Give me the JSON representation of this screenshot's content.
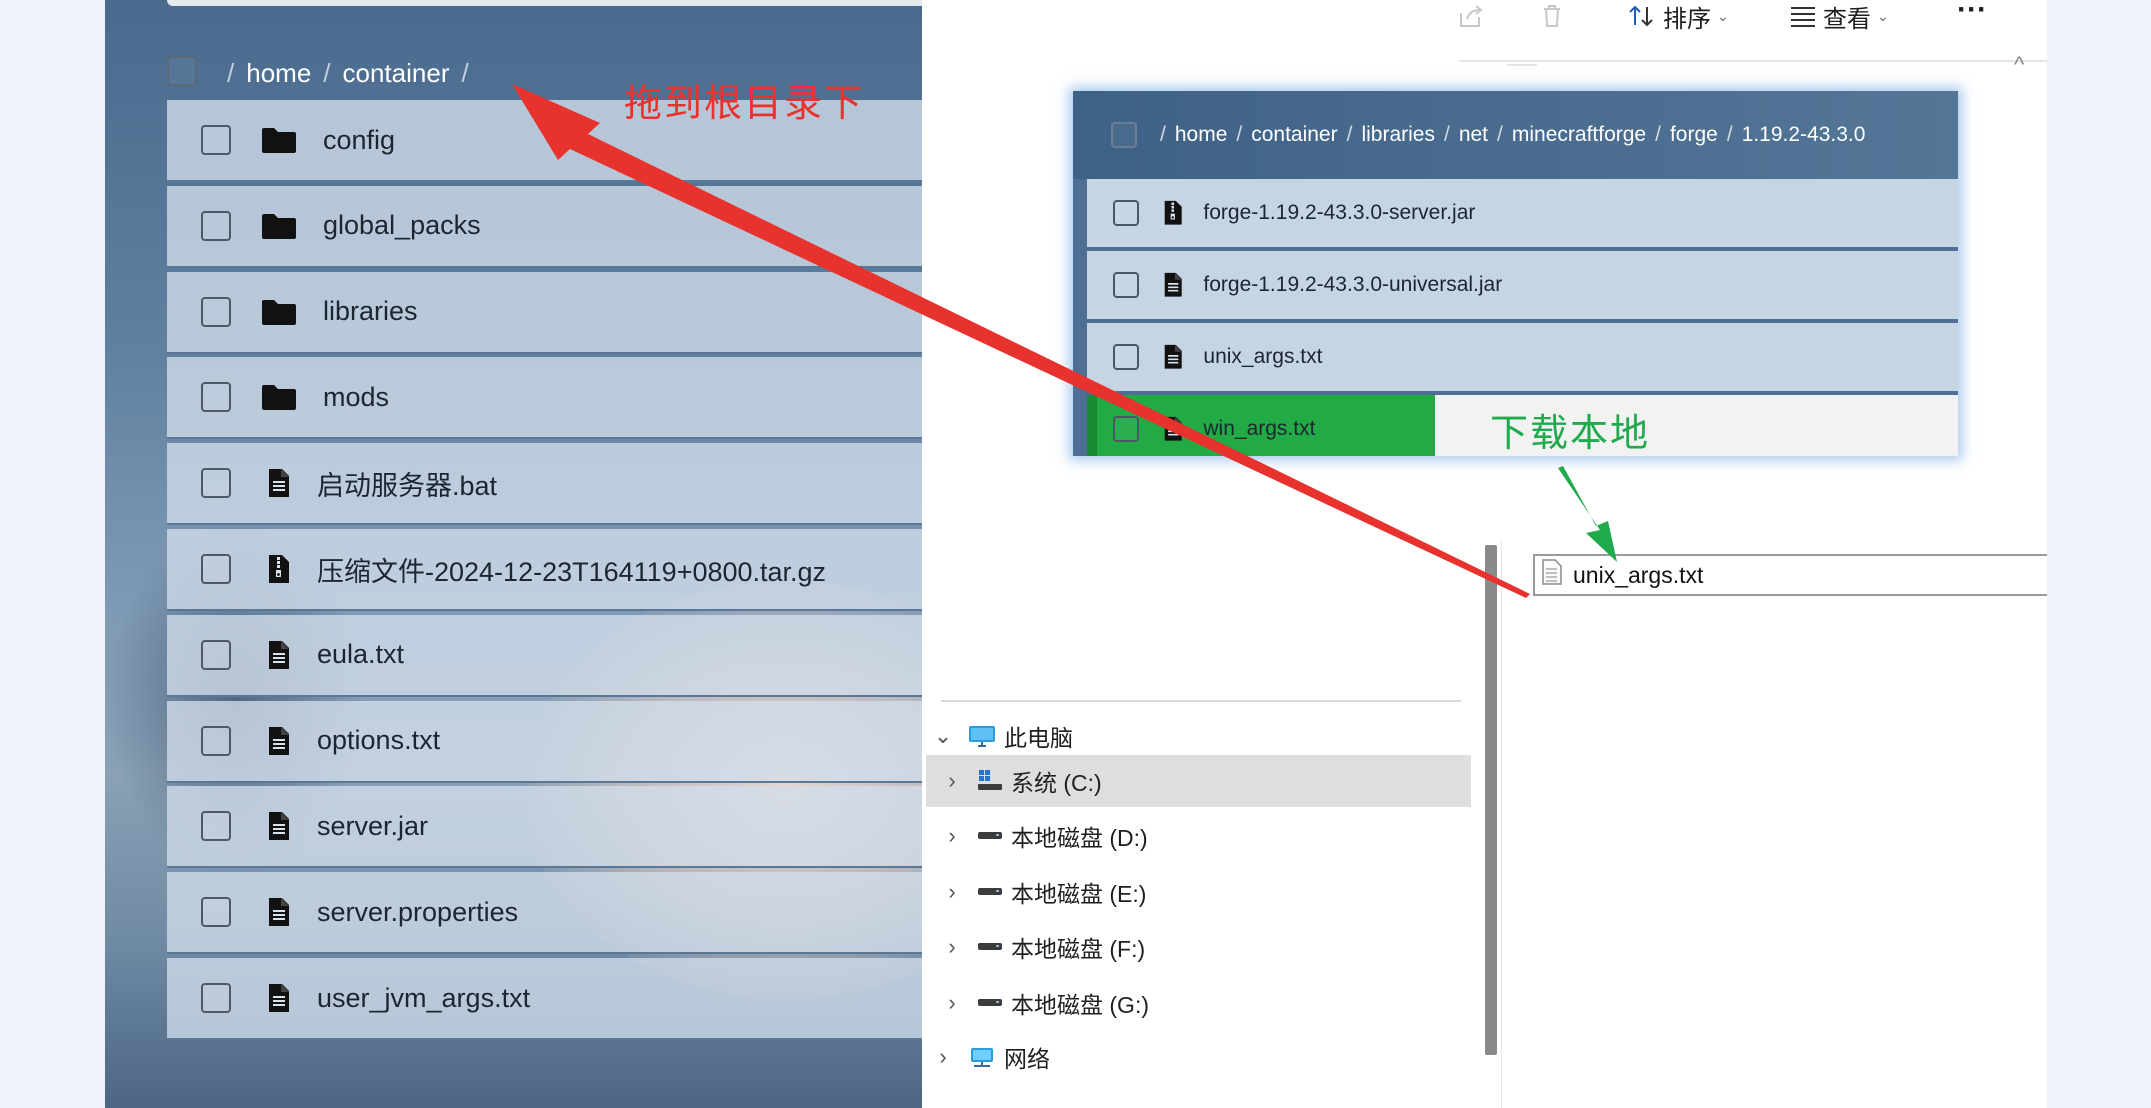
{
  "web_panel": {
    "breadcrumb": [
      "home",
      "container"
    ],
    "files": [
      {
        "name": "config",
        "type": "folder"
      },
      {
        "name": "global_packs",
        "type": "folder"
      },
      {
        "name": "libraries",
        "type": "folder"
      },
      {
        "name": "mods",
        "type": "folder"
      },
      {
        "name": "启动服务器.bat",
        "type": "file"
      },
      {
        "name": "压缩文件-2024-12-23T164119+0800.tar.gz",
        "type": "archive"
      },
      {
        "name": "eula.txt",
        "type": "file"
      },
      {
        "name": "options.txt",
        "type": "file"
      },
      {
        "name": "server.jar",
        "type": "file"
      },
      {
        "name": "server.properties",
        "type": "file"
      },
      {
        "name": "user_jvm_args.txt",
        "type": "file"
      }
    ]
  },
  "drag_ghost": {
    "breadcrumb": [
      "home",
      "container",
      "libraries",
      "net",
      "minecraftforge",
      "forge",
      "1.19.2-43.3.0"
    ],
    "files": [
      {
        "name": "forge-1.19.2-43.3.0-server.jar",
        "type": "archive"
      },
      {
        "name": "forge-1.19.2-43.3.0-universal.jar",
        "type": "file"
      },
      {
        "name": "unix_args.txt",
        "type": "file"
      },
      {
        "name": "win_args.txt",
        "type": "file"
      }
    ]
  },
  "annotations": {
    "drag_to_root": "拖到根目录下",
    "download_local": "下载本地",
    "red_color": "#e8322e",
    "green_color": "#1faa4c"
  },
  "explorer": {
    "toolbar": {
      "sort_label": "排序",
      "view_label": "查看",
      "more_label": "···"
    },
    "dropped_file": "unix_args.txt",
    "nav_tree": [
      {
        "label": "此电脑",
        "icon": "monitor-icon",
        "expanded": true
      },
      {
        "label": "系统 (C:)",
        "icon": "windows-drive-icon",
        "selected": true
      },
      {
        "label": "本地磁盘 (D:)",
        "icon": "drive-icon"
      },
      {
        "label": "本地磁盘 (E:)",
        "icon": "drive-icon"
      },
      {
        "label": "本地磁盘 (F:)",
        "icon": "drive-icon"
      },
      {
        "label": "本地磁盘 (G:)",
        "icon": "drive-icon"
      },
      {
        "label": "网络",
        "icon": "network-icon"
      }
    ]
  }
}
